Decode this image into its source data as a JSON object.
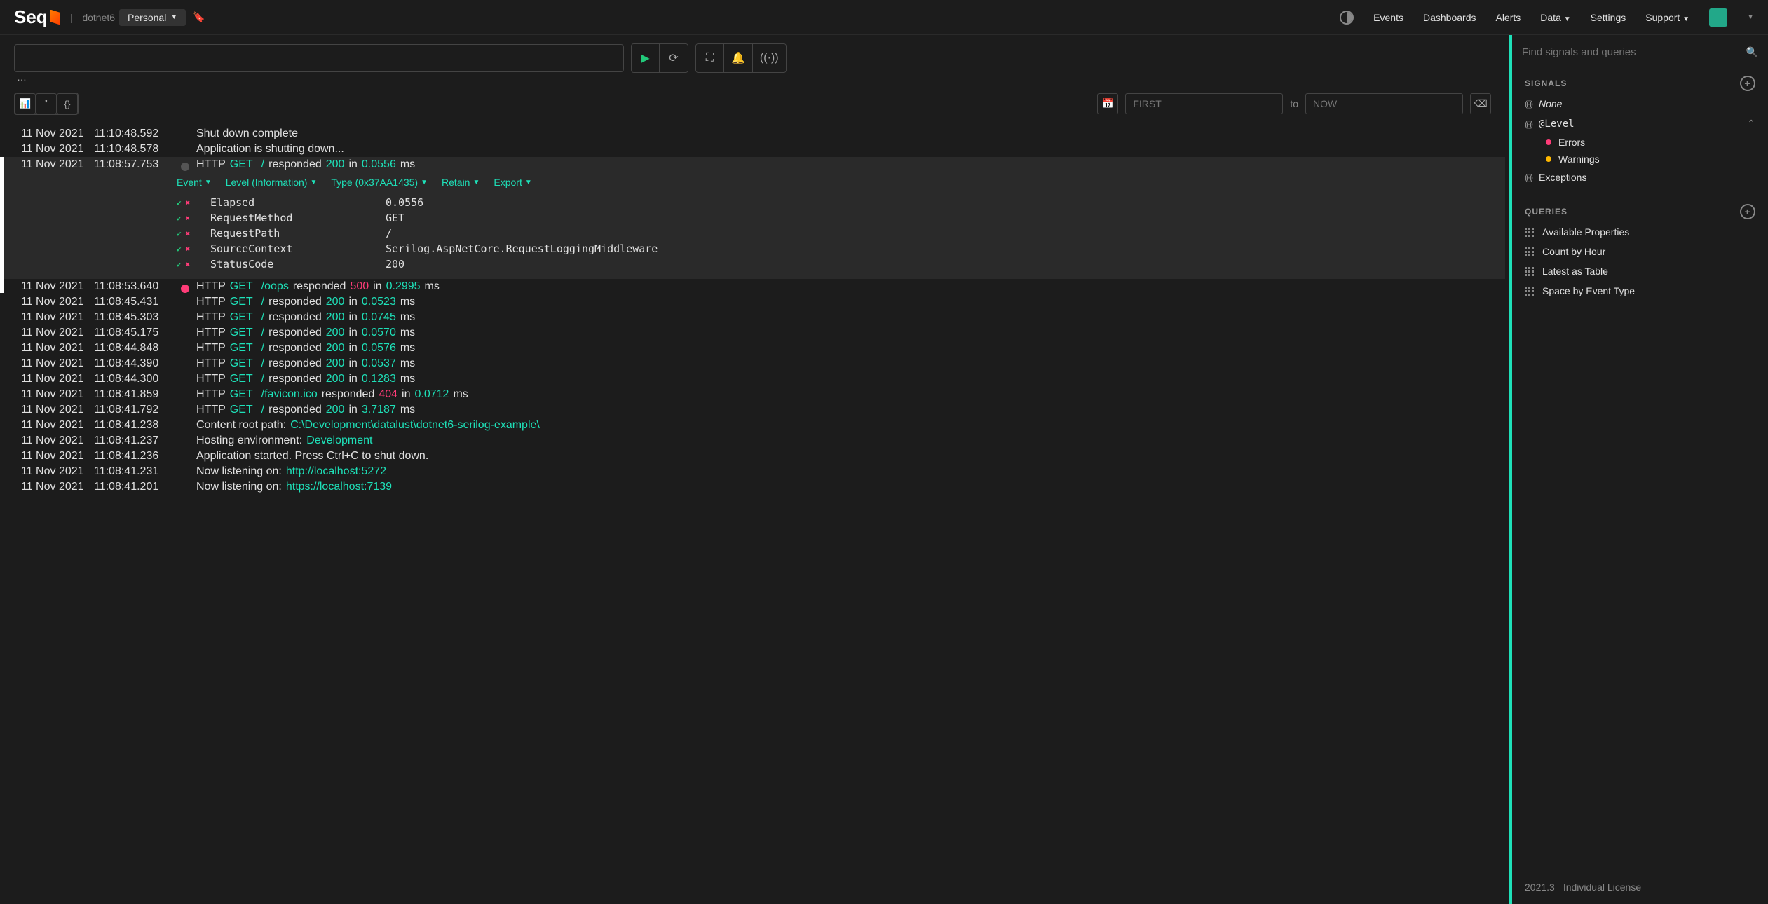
{
  "header": {
    "logo": "Seq",
    "project": "dotnet6",
    "workspace": "Personal",
    "nav": [
      "Events",
      "Dashboards",
      "Alerts",
      "Data",
      "Settings",
      "Support"
    ]
  },
  "right": {
    "search_placeholder": "Find signals and queries",
    "signals_hdr": "SIGNALS",
    "signals": {
      "none": "None",
      "level": "@Level",
      "errors": "Errors",
      "warnings": "Warnings",
      "exceptions": "Exceptions"
    },
    "queries_hdr": "QUERIES",
    "queries": [
      "Available Properties",
      "Count by Hour",
      "Latest as Table",
      "Space by Event Type"
    ],
    "footer_version": "2021.3",
    "footer_license": "Individual License"
  },
  "filters": {
    "first_placeholder": "FIRST",
    "to": "to",
    "now_placeholder": "NOW"
  },
  "expanded_menu": {
    "event": "Event",
    "level": "Level (Information)",
    "type": "Type (0x37AA1435)",
    "retain": "Retain",
    "export": "Export"
  },
  "properties": [
    {
      "name": "Elapsed",
      "value": "0.0556"
    },
    {
      "name": "RequestMethod",
      "value": "GET"
    },
    {
      "name": "RequestPath",
      "value": "/"
    },
    {
      "name": "SourceContext",
      "value": "Serilog.AspNetCore.RequestLoggingMiddleware"
    },
    {
      "name": "StatusCode",
      "value": "200"
    }
  ],
  "logs": [
    {
      "date": "11 Nov 2021",
      "time": "11:10:48.592",
      "mark": "",
      "parts": [
        {
          "t": "Shut down complete"
        }
      ]
    },
    {
      "date": "11 Nov 2021",
      "time": "11:10:48.578",
      "mark": "",
      "parts": [
        {
          "t": "Application is shutting down..."
        }
      ]
    },
    {
      "date": "11 Nov 2021",
      "time": "11:08:57.753",
      "mark": "grey",
      "selected": true,
      "parts": [
        {
          "t": "HTTP "
        },
        {
          "t": "GET",
          "c": "teal"
        },
        {
          "t": " "
        },
        {
          "t": "/",
          "c": "teal"
        },
        {
          "t": " responded "
        },
        {
          "t": "200",
          "c": "teal"
        },
        {
          "t": " in "
        },
        {
          "t": "0.0556",
          "c": "teal"
        },
        {
          "t": " ms"
        }
      ]
    },
    {
      "date": "11 Nov 2021",
      "time": "11:08:53.640",
      "mark": "redm",
      "parts": [
        {
          "t": "HTTP "
        },
        {
          "t": "GET",
          "c": "teal"
        },
        {
          "t": " "
        },
        {
          "t": "/oops",
          "c": "teal"
        },
        {
          "t": " responded "
        },
        {
          "t": "500",
          "c": "redt"
        },
        {
          "t": " in "
        },
        {
          "t": "0.2995",
          "c": "teal"
        },
        {
          "t": " ms"
        }
      ]
    },
    {
      "date": "11 Nov 2021",
      "time": "11:08:45.431",
      "mark": "",
      "parts": [
        {
          "t": "HTTP "
        },
        {
          "t": "GET",
          "c": "teal"
        },
        {
          "t": " "
        },
        {
          "t": "/",
          "c": "teal"
        },
        {
          "t": " responded "
        },
        {
          "t": "200",
          "c": "teal"
        },
        {
          "t": " in "
        },
        {
          "t": "0.0523",
          "c": "teal"
        },
        {
          "t": " ms"
        }
      ]
    },
    {
      "date": "11 Nov 2021",
      "time": "11:08:45.303",
      "mark": "",
      "parts": [
        {
          "t": "HTTP "
        },
        {
          "t": "GET",
          "c": "teal"
        },
        {
          "t": " "
        },
        {
          "t": "/",
          "c": "teal"
        },
        {
          "t": " responded "
        },
        {
          "t": "200",
          "c": "teal"
        },
        {
          "t": " in "
        },
        {
          "t": "0.0745",
          "c": "teal"
        },
        {
          "t": " ms"
        }
      ]
    },
    {
      "date": "11 Nov 2021",
      "time": "11:08:45.175",
      "mark": "",
      "parts": [
        {
          "t": "HTTP "
        },
        {
          "t": "GET",
          "c": "teal"
        },
        {
          "t": " "
        },
        {
          "t": "/",
          "c": "teal"
        },
        {
          "t": " responded "
        },
        {
          "t": "200",
          "c": "teal"
        },
        {
          "t": " in "
        },
        {
          "t": "0.0570",
          "c": "teal"
        },
        {
          "t": " ms"
        }
      ]
    },
    {
      "date": "11 Nov 2021",
      "time": "11:08:44.848",
      "mark": "",
      "parts": [
        {
          "t": "HTTP "
        },
        {
          "t": "GET",
          "c": "teal"
        },
        {
          "t": " "
        },
        {
          "t": "/",
          "c": "teal"
        },
        {
          "t": " responded "
        },
        {
          "t": "200",
          "c": "teal"
        },
        {
          "t": " in "
        },
        {
          "t": "0.0576",
          "c": "teal"
        },
        {
          "t": " ms"
        }
      ]
    },
    {
      "date": "11 Nov 2021",
      "time": "11:08:44.390",
      "mark": "",
      "parts": [
        {
          "t": "HTTP "
        },
        {
          "t": "GET",
          "c": "teal"
        },
        {
          "t": " "
        },
        {
          "t": "/",
          "c": "teal"
        },
        {
          "t": " responded "
        },
        {
          "t": "200",
          "c": "teal"
        },
        {
          "t": " in "
        },
        {
          "t": "0.0537",
          "c": "teal"
        },
        {
          "t": " ms"
        }
      ]
    },
    {
      "date": "11 Nov 2021",
      "time": "11:08:44.300",
      "mark": "",
      "parts": [
        {
          "t": "HTTP "
        },
        {
          "t": "GET",
          "c": "teal"
        },
        {
          "t": " "
        },
        {
          "t": "/",
          "c": "teal"
        },
        {
          "t": " responded "
        },
        {
          "t": "200",
          "c": "teal"
        },
        {
          "t": " in "
        },
        {
          "t": "0.1283",
          "c": "teal"
        },
        {
          "t": " ms"
        }
      ]
    },
    {
      "date": "11 Nov 2021",
      "time": "11:08:41.859",
      "mark": "",
      "parts": [
        {
          "t": "HTTP "
        },
        {
          "t": "GET",
          "c": "teal"
        },
        {
          "t": " "
        },
        {
          "t": "/favicon.ico",
          "c": "teal"
        },
        {
          "t": " responded "
        },
        {
          "t": "404",
          "c": "redt"
        },
        {
          "t": " in "
        },
        {
          "t": "0.0712",
          "c": "teal"
        },
        {
          "t": " ms"
        }
      ]
    },
    {
      "date": "11 Nov 2021",
      "time": "11:08:41.792",
      "mark": "",
      "parts": [
        {
          "t": "HTTP "
        },
        {
          "t": "GET",
          "c": "teal"
        },
        {
          "t": " "
        },
        {
          "t": "/",
          "c": "teal"
        },
        {
          "t": " responded "
        },
        {
          "t": "200",
          "c": "teal"
        },
        {
          "t": " in "
        },
        {
          "t": "3.7187",
          "c": "teal"
        },
        {
          "t": " ms"
        }
      ]
    },
    {
      "date": "11 Nov 2021",
      "time": "11:08:41.238",
      "mark": "",
      "parts": [
        {
          "t": "Content root path: "
        },
        {
          "t": "C:\\Development\\datalust\\dotnet6-serilog-example\\",
          "c": "teal"
        }
      ]
    },
    {
      "date": "11 Nov 2021",
      "time": "11:08:41.237",
      "mark": "",
      "parts": [
        {
          "t": "Hosting environment: "
        },
        {
          "t": "Development",
          "c": "teal"
        }
      ]
    },
    {
      "date": "11 Nov 2021",
      "time": "11:08:41.236",
      "mark": "",
      "parts": [
        {
          "t": "Application started. Press Ctrl+C to shut down."
        }
      ]
    },
    {
      "date": "11 Nov 2021",
      "time": "11:08:41.231",
      "mark": "",
      "parts": [
        {
          "t": "Now listening on: "
        },
        {
          "t": "http://localhost:5272",
          "c": "teal"
        }
      ]
    },
    {
      "date": "11 Nov 2021",
      "time": "11:08:41.201",
      "mark": "",
      "parts": [
        {
          "t": "Now listening on: "
        },
        {
          "t": "https://localhost:7139",
          "c": "teal"
        }
      ]
    }
  ]
}
